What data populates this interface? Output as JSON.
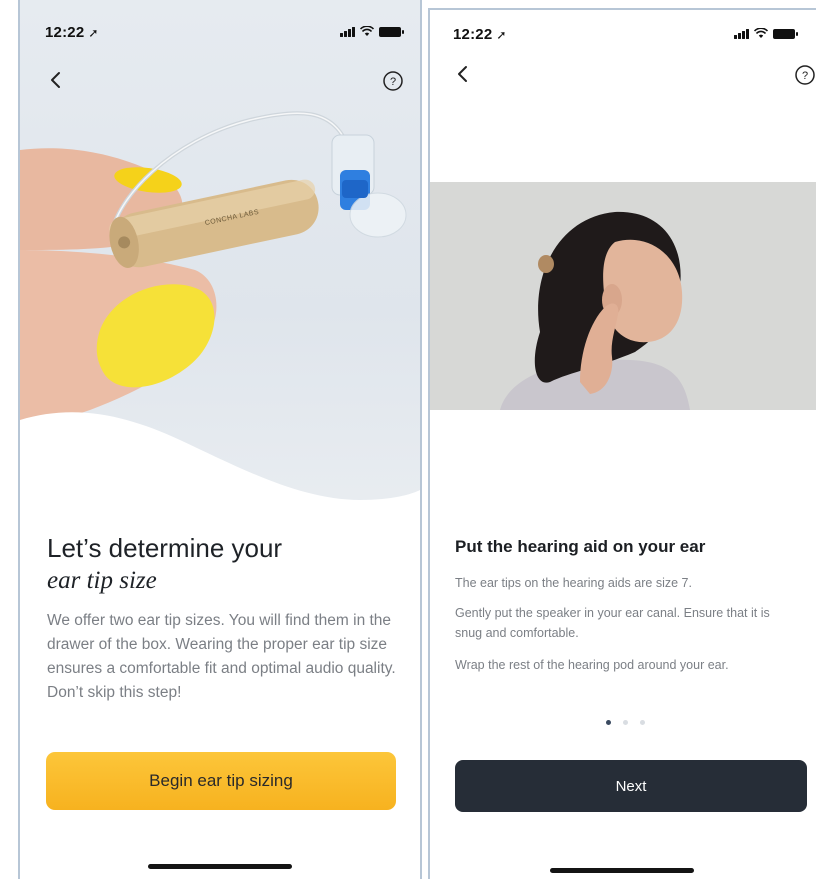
{
  "screen1": {
    "status": {
      "time": "12:22"
    },
    "device_label": "CONCHA LABS",
    "title_line1": "Let’s determine your",
    "title_line2": "ear tip size",
    "body": "We offer two ear tip sizes. You will find them in the drawer of the box. Wearing the proper ear tip size ensures a comfortable fit and optimal audio quality. Don’t skip this step!",
    "primary_button": "Begin ear tip sizing"
  },
  "screen2": {
    "status": {
      "time": "12:22"
    },
    "title": "Put the hearing aid on your ear",
    "paragraphs": [
      "The ear tips on the hearing aids are size 7.",
      "Gently put the speaker in your ear canal. Ensure that it is snug and comfortable.",
      "Wrap the rest of the hearing pod around your ear."
    ],
    "pager": {
      "current": 1,
      "total": 3
    },
    "next_button": "Next"
  },
  "colors": {
    "accent_yellow": "#f9bb27",
    "dark_button": "#262d37",
    "text_muted": "#7b7f85",
    "hearing_aid_tip_blue": "#2f7fe0"
  }
}
